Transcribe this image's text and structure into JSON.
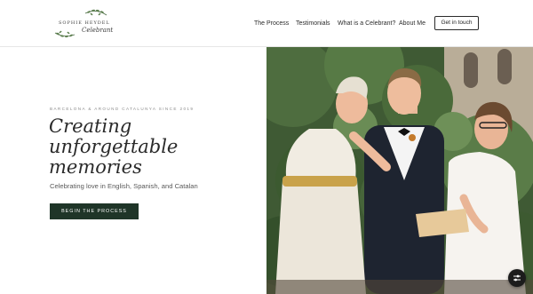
{
  "header": {
    "logo": {
      "line1": "SOPHIE HEYDEL",
      "line2": "Celebrant"
    },
    "nav": [
      {
        "label": "The Process"
      },
      {
        "label": "Testimonials"
      },
      {
        "label": "What is a Celebrant?"
      },
      {
        "label": "About Me"
      }
    ],
    "cta_label": "Get in touch"
  },
  "hero": {
    "tagline": "BARCELONA & AROUND CATALUNYA SINCE 2019",
    "headline": [
      "Creating",
      "unforgettable",
      "memories"
    ],
    "subline": "Celebrating love in English, Spanish, and Catalan",
    "button_label": "BEGIN THE PROCESS"
  },
  "colors": {
    "accent_dark_green": "#1f3528",
    "text": "#2b2b2b",
    "background": "#ffffff"
  },
  "icons": {
    "floating_button": "accessibility-sliders-icon"
  }
}
